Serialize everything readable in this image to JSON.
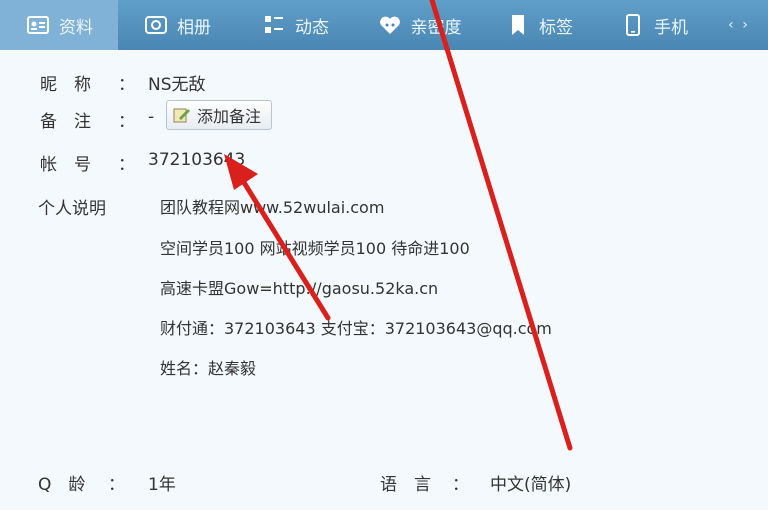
{
  "tabs": [
    {
      "label": "资料",
      "icon": "profile-card-icon",
      "active": true
    },
    {
      "label": "相册",
      "icon": "photo-album-icon",
      "active": false
    },
    {
      "label": "动态",
      "icon": "feed-icon",
      "active": false
    },
    {
      "label": "亲密度",
      "icon": "intimacy-icon",
      "active": false
    },
    {
      "label": "标签",
      "icon": "bookmark-icon",
      "active": false
    },
    {
      "label": "手机",
      "icon": "phone-icon",
      "active": false
    }
  ],
  "tab_more": "‹ ›",
  "profile": {
    "nickname_label": "昵　称",
    "nickname": "NS无敌",
    "remark_label": "备　注",
    "remark_value": "-",
    "add_remark_button": "添加备注",
    "account_label": "帐　号",
    "account": "372103643",
    "bio_label": "个人说明",
    "bio_lines": [
      "团队教程网www.52wulai.com",
      "空间学员100 网站视频学员100 待命进100",
      "高速卡盟Gow=http://gaosu.52ka.cn",
      "财付通：372103643 支付宝：372103643@qq.com",
      "姓名：赵秦毅"
    ],
    "qage_label": "Q　龄",
    "qage": "1年",
    "language_label": "语　言",
    "language": "中文(简体)"
  },
  "colors": {
    "tabbar": "#4a86b3",
    "tab_active": "#7fb2d6",
    "panel": "#f3f9fd",
    "arrow": "#d9201c"
  },
  "colon": "："
}
